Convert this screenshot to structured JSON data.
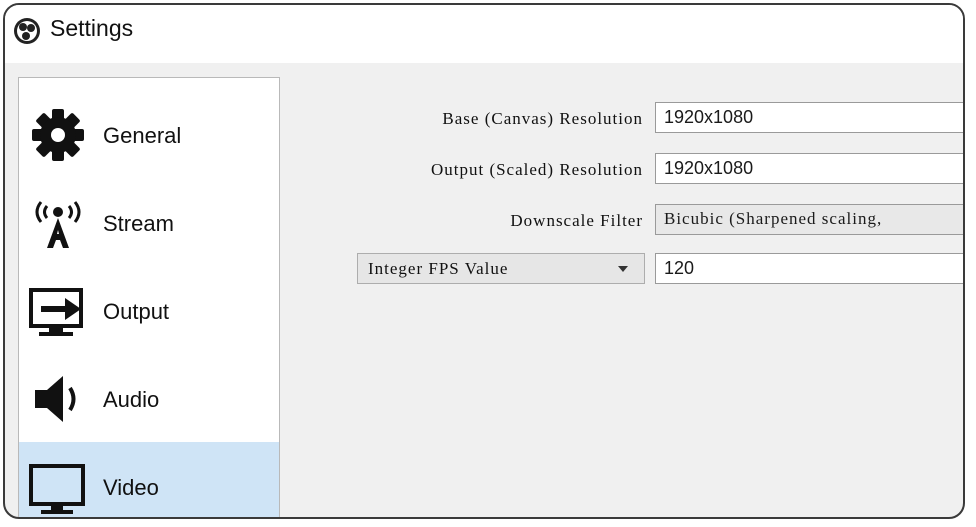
{
  "window": {
    "title": "Settings",
    "logo_icon": "obs-logo-icon"
  },
  "sidebar": {
    "items": [
      {
        "label": "General",
        "icon": "gear-icon",
        "selected": false
      },
      {
        "label": "Stream",
        "icon": "antenna-icon",
        "selected": false
      },
      {
        "label": "Output",
        "icon": "monitor-arrow-icon",
        "selected": false
      },
      {
        "label": "Audio",
        "icon": "speaker-icon",
        "selected": false
      },
      {
        "label": "Video",
        "icon": "monitor-icon",
        "selected": true
      }
    ],
    "selected_color": "#cfe4f6"
  },
  "video": {
    "base_label": "Base (Canvas) Resolution",
    "base_value": "1920x1080",
    "output_label": "Output (Scaled) Resolution",
    "output_value": "1920x1080",
    "downscale_label": "Downscale Filter",
    "downscale_value": "Bicubic (Sharpened scaling,",
    "fps_type": "Integer FPS Value",
    "fps_value": "120"
  }
}
